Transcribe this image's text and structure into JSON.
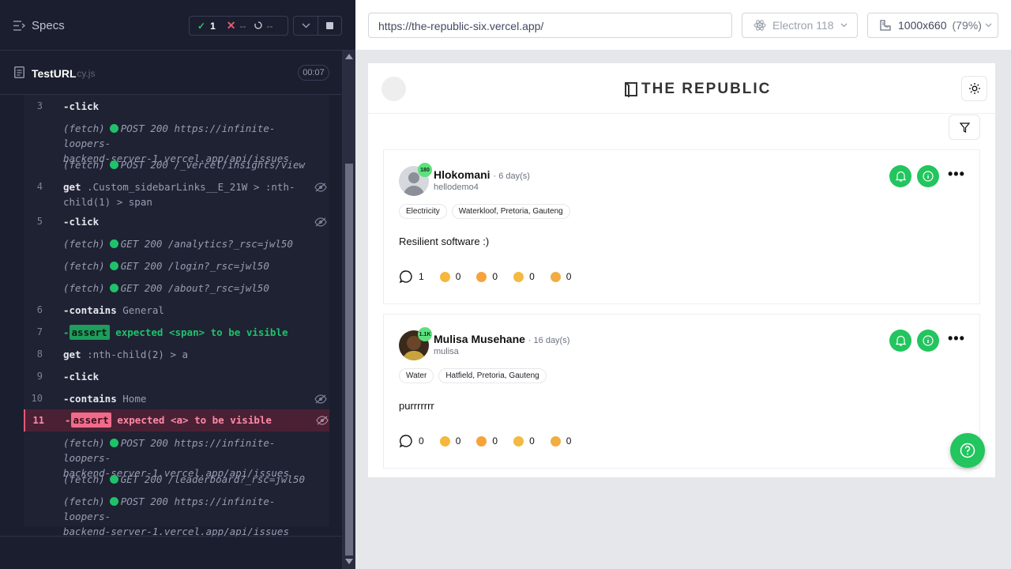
{
  "runner": {
    "specs_label": "Specs",
    "stats": {
      "passed": "1",
      "failed": "--",
      "pending": "--"
    },
    "file": {
      "name": "TestURL",
      "ext": ".cy.js",
      "duration": "00:07"
    }
  },
  "commands": [
    {
      "num": "3",
      "kw": "-click",
      "arg": ""
    },
    {
      "fetch": "(fetch)",
      "method": "POST 200",
      "url_lines": [
        "https://infinite-loopers-",
        "backend-server-1.vercel.app/api/issues"
      ]
    },
    {
      "fetch": "(fetch)",
      "method": "POST 200",
      "url_lines": [
        "/_vercel/insights/view"
      ]
    },
    {
      "num": "4",
      "kw": "get",
      "arg_lines": [
        ".Custom_sidebarLinks__E_21W > :nth-",
        "child(1) > span"
      ]
    },
    {
      "num": "5",
      "kw": "-click",
      "arg": ""
    },
    {
      "fetch": "(fetch)",
      "method": "GET 200",
      "url_lines": [
        "/analytics?_rsc=jwl50"
      ]
    },
    {
      "fetch": "(fetch)",
      "method": "GET 200",
      "url_lines": [
        "/login?_rsc=jwl50"
      ]
    },
    {
      "fetch": "(fetch)",
      "method": "GET 200",
      "url_lines": [
        "/about?_rsc=jwl50"
      ]
    },
    {
      "num": "6",
      "kw": "-contains",
      "arg": "General"
    },
    {
      "num": "7",
      "kw": "-",
      "tag": "assert",
      "a1": "expected",
      "a2": "<span>",
      "a3": "to be",
      "a4": "visible"
    },
    {
      "num": "8",
      "kw": "get",
      "arg": ":nth-child(2) > a"
    },
    {
      "num": "9",
      "kw": "-click",
      "arg": ""
    },
    {
      "num": "10",
      "kw": "-contains",
      "arg": "Home"
    },
    {
      "num": "11",
      "kw": "-",
      "tag": "assert",
      "a1": "expected",
      "a2": "<a>",
      "a3": "to be",
      "a4": "visible"
    },
    {
      "fetch": "(fetch)",
      "method": "POST 200",
      "url_lines": [
        "https://infinite-loopers-",
        "backend-server-1.vercel.app/api/issues"
      ]
    },
    {
      "fetch": "(fetch)",
      "method": "GET 200",
      "url_lines": [
        "/leaderboard?_rsc=jwl50"
      ]
    },
    {
      "fetch": "(fetch)",
      "method": "POST 200",
      "url_lines": [
        "https://infinite-loopers-",
        "backend-server-1.vercel.app/api/issues"
      ]
    }
  ],
  "toolbar": {
    "url": "https://the-republic-six.vercel.app/",
    "browser": "Electron 118",
    "viewport": "1000x660",
    "zoom": "(79%)"
  },
  "app": {
    "logo_text": "THE REPUBLIC",
    "posts": [
      {
        "name": "Hlokomani",
        "time": "· 6 day(s)",
        "handle": "hellodemo4",
        "badge": "180",
        "tags": [
          "Electricity",
          "Waterkloof, Pretoria, Gauteng"
        ],
        "body": "Resilient software :)",
        "comments": "1",
        "reactions": [
          "0",
          "0",
          "0",
          "0"
        ]
      },
      {
        "name": "Mulisa Musehane",
        "time": "· 16 day(s)",
        "handle": "mulisa",
        "badge": "1.1K",
        "tags": [
          "Water",
          "Hatfield, Pretoria, Gauteng"
        ],
        "body": "purrrrrrr",
        "comments": "0",
        "reactions": [
          "0",
          "0",
          "0",
          "0"
        ]
      }
    ]
  },
  "colors": {
    "accent_green": "#22c55e",
    "fail_red": "#e35a78",
    "runner_bg": "#1b1e2e"
  }
}
